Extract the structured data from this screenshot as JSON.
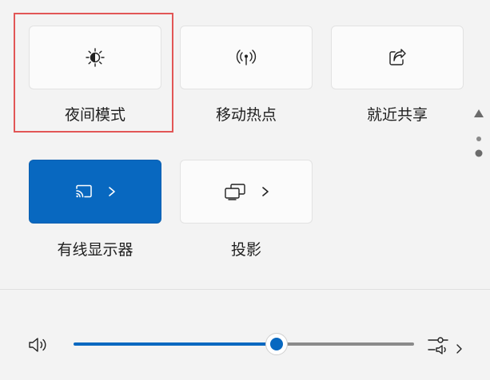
{
  "tiles": [
    {
      "label": "夜间模式",
      "icon": "night-light-icon",
      "active": false
    },
    {
      "label": "移动热点",
      "icon": "mobile-hotspot-icon",
      "active": false
    },
    {
      "label": "就近共享",
      "icon": "nearby-share-icon",
      "active": false
    },
    {
      "label": "有线显示器",
      "icon": "cast-icon",
      "active": true
    },
    {
      "label": "投影",
      "icon": "project-icon",
      "active": false
    }
  ],
  "volume": {
    "level": 0.5
  },
  "colors": {
    "accent": "#0868c0",
    "highlight": "#e25656",
    "background": "#f3f3f3"
  }
}
